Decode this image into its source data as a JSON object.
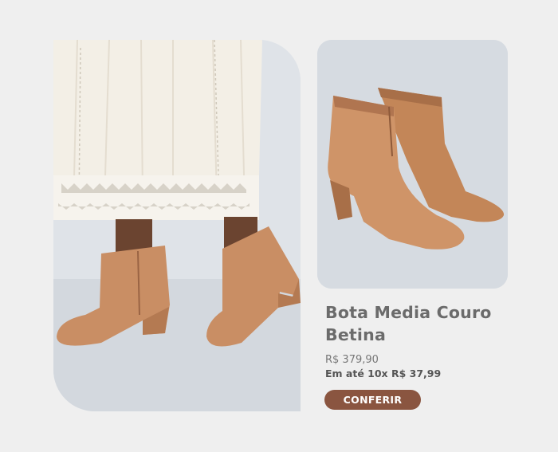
{
  "product": {
    "title": "Bota Media Couro Betina",
    "price": "R$ 379,90",
    "installments": "Em até 10x R$ 37,99",
    "cta_label": "CONFERIR"
  },
  "images": {
    "left": "photo-model-wearing-boots",
    "right": "photo-boots-pair"
  },
  "colors": {
    "background": "#efefef",
    "leather": "#c98e64",
    "button": "#8a5540",
    "title": "#6b6b6b"
  }
}
